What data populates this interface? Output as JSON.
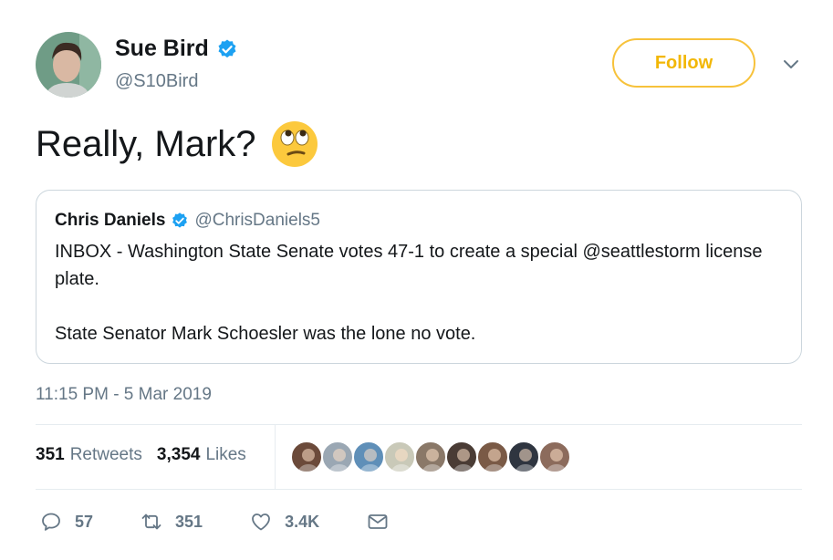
{
  "author": {
    "name": "Sue Bird",
    "handle": "@S10Bird",
    "verified": true
  },
  "follow_button": {
    "label": "Follow"
  },
  "tweet": {
    "text": "Really, Mark?",
    "emoji": "face-with-rolling-eyes"
  },
  "quote": {
    "name": "Chris Daniels",
    "handle": "@ChrisDaniels5",
    "verified": true,
    "text": "INBOX - Washington State Senate votes 47-1 to create a special @seattlestorm license plate.\n\nState Senator Mark Schoesler was the lone no vote."
  },
  "timestamp": "11:15 PM - 5 Mar 2019",
  "stats": {
    "retweets_count": "351",
    "retweets_label": "Retweets",
    "likes_count": "3,354",
    "likes_label": "Likes"
  },
  "liker_avatars": [
    "#6b4a3a",
    "#9aa7b3",
    "#5f8fb8",
    "#c9c9b8",
    "#8a7868",
    "#4a3c35",
    "#7a5a46",
    "#2f3540",
    "#8c6b5c"
  ],
  "actions": {
    "reply_count": "57",
    "retweet_count": "351",
    "like_count": "3.4K"
  },
  "colors": {
    "accent_follow": "#f2b705",
    "verified_blue": "#1da1f2",
    "muted_text": "#657786",
    "border": "#ccd6dd"
  }
}
